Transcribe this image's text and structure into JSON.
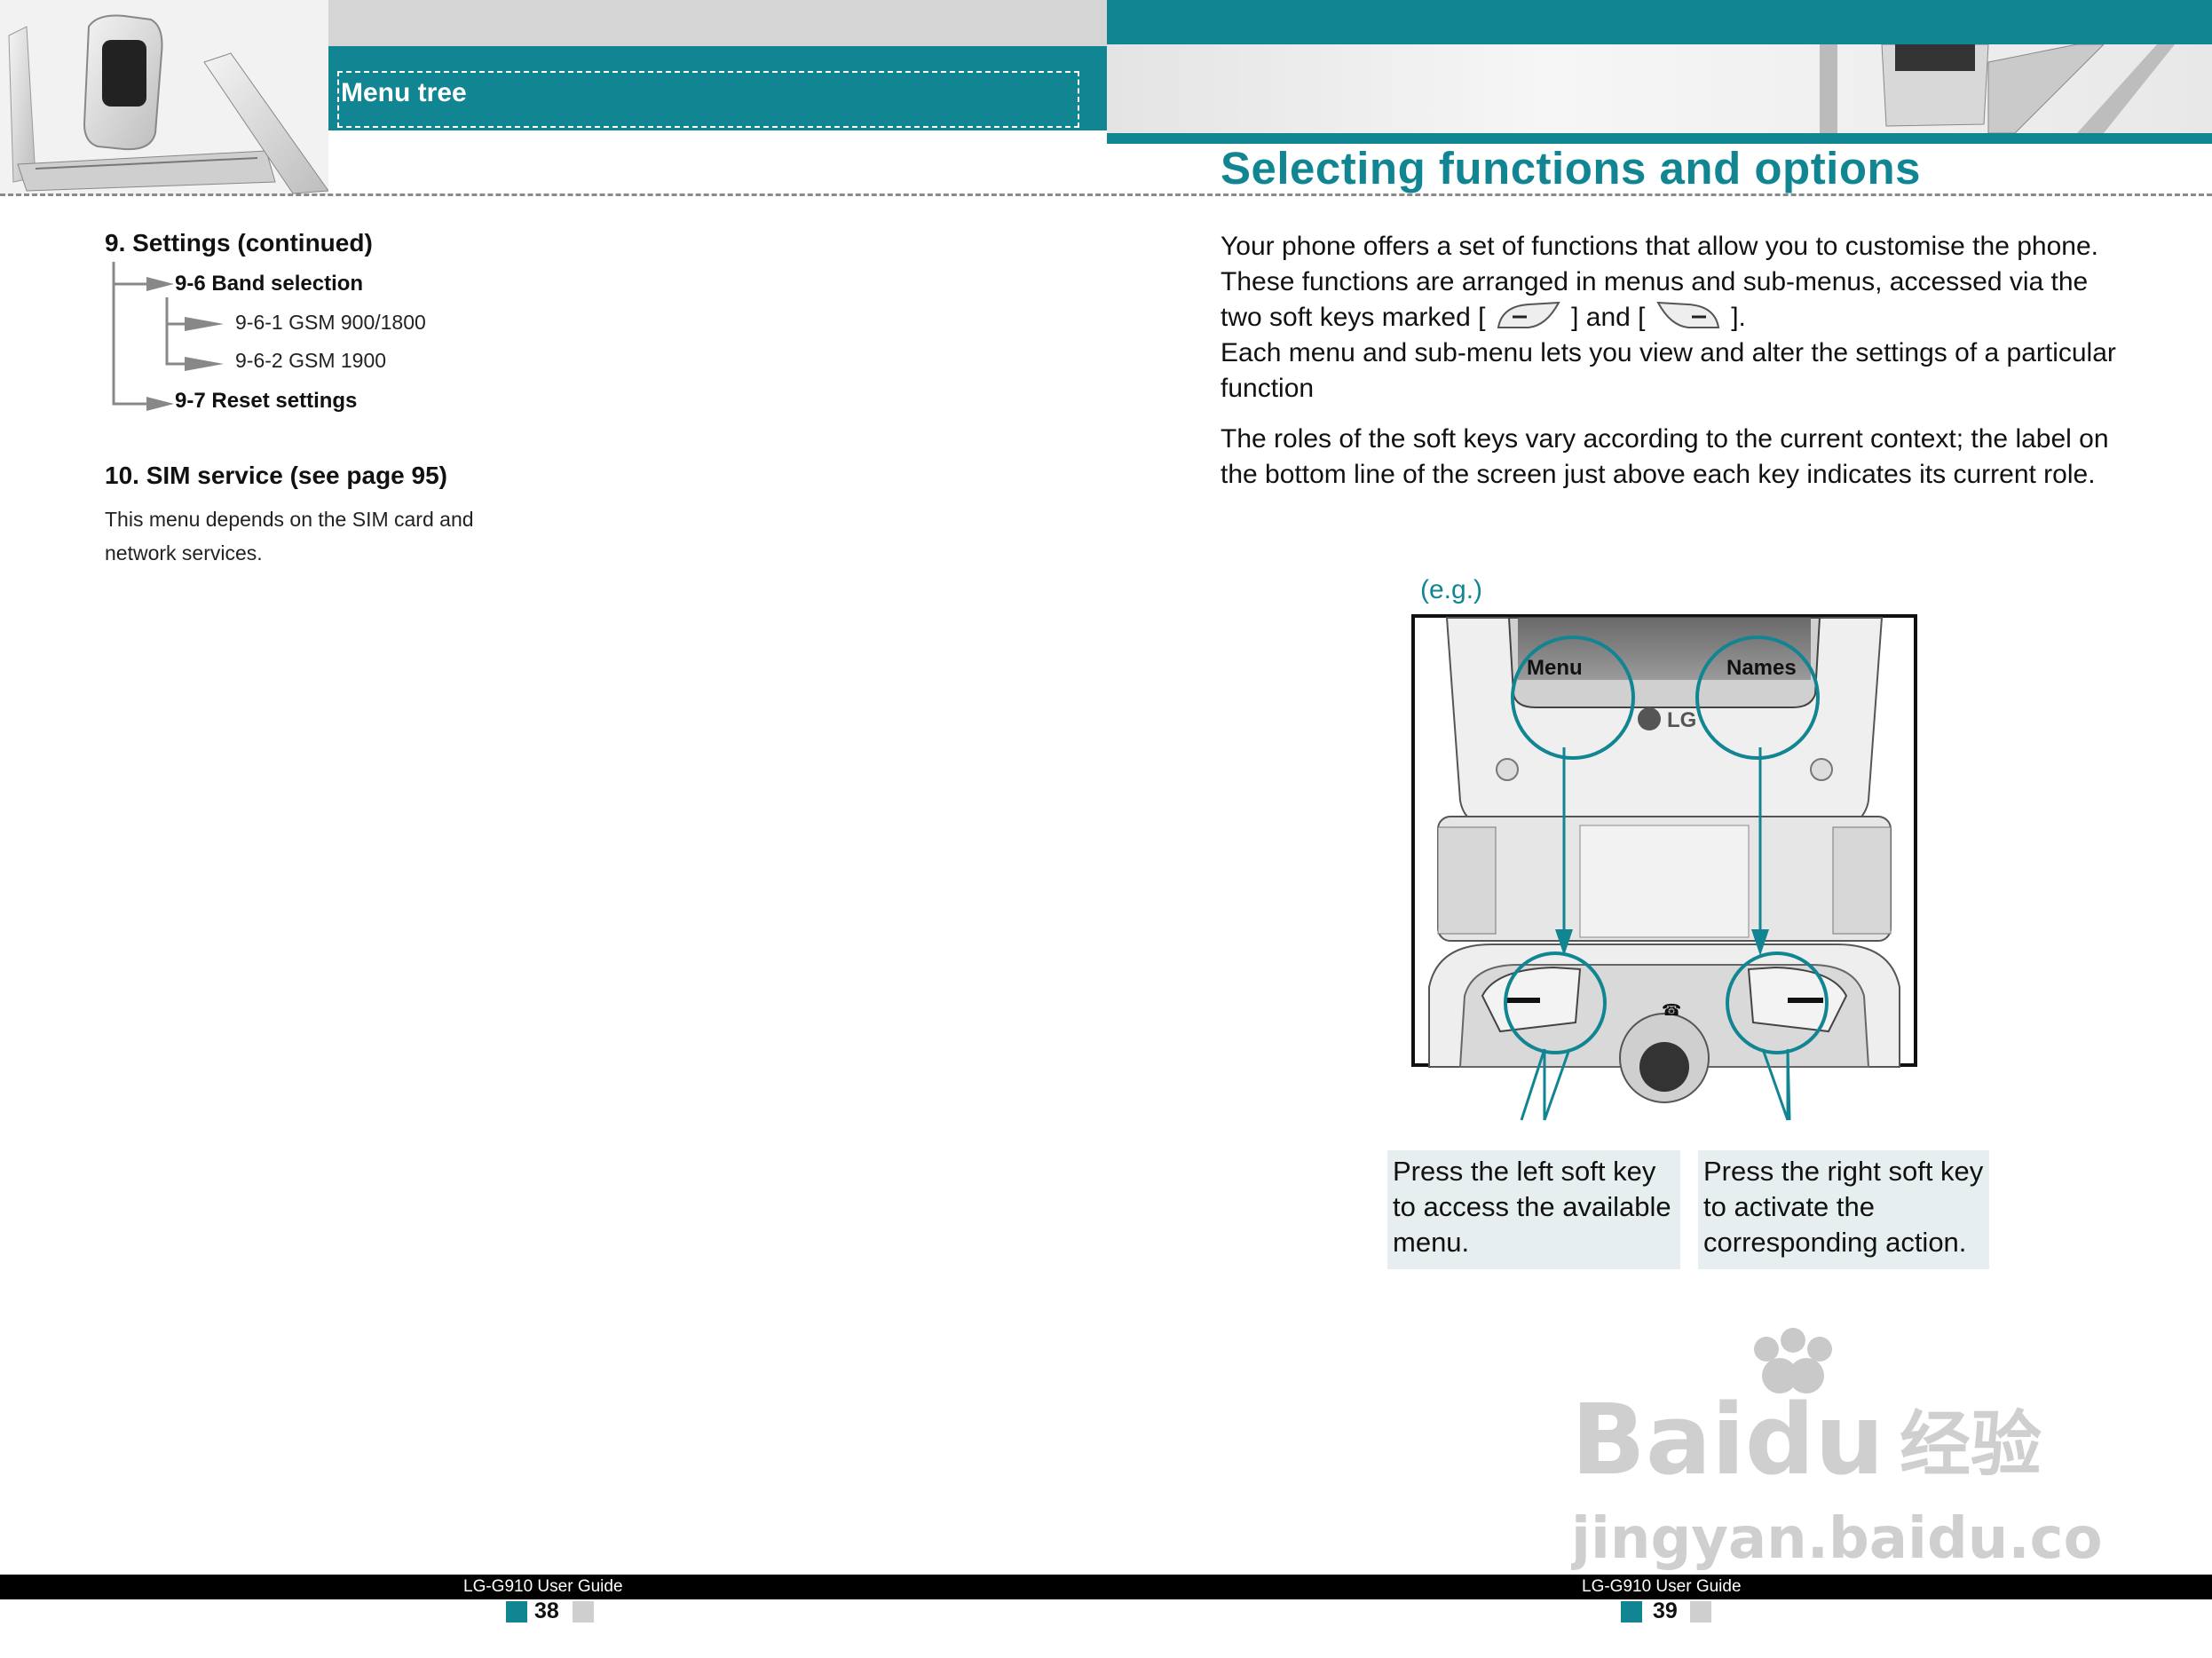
{
  "header": {
    "section_label": "Menu tree",
    "page_title": "Selecting functions and options"
  },
  "left_page": {
    "settings_heading": "9. Settings (continued)",
    "tree": [
      {
        "label": "9-6 Band selection",
        "level": 1
      },
      {
        "label": "9-6-1 GSM 900/1800",
        "level": 2
      },
      {
        "label": "9-6-2 GSM 1900",
        "level": 2
      },
      {
        "label": "9-7 Reset settings",
        "level": 1
      }
    ],
    "sim_heading": "10. SIM service (see page 95)",
    "sim_desc_1": "This menu depends on the SIM card and",
    "sim_desc_2": "network services."
  },
  "right_page": {
    "para1_a": "Your phone offers a set of functions that allow you to customise the phone. These functions are arranged in menus and sub-menus, accessed via the two soft keys marked [",
    "para1_b": "] and [",
    "para1_c": "].",
    "para1_d": "Each menu and sub-menu lets you view and alter the settings of a particular function",
    "para2": "The roles of the soft keys vary according to the current context; the label on the bottom line of the screen just above each key indicates its current role.",
    "eg_label": "(e.g.)",
    "screen_left_label": "Menu",
    "screen_right_label": "Names",
    "phone_brand": "LG",
    "caption_left": "Press the left soft key to access the available menu.",
    "caption_right": "Press the right soft key to activate the corresponding action."
  },
  "footer": {
    "left_guide": "LG-G910 User Guide",
    "left_page_num": "38",
    "right_guide": "LG-G910 User Guide",
    "right_page_num": "39"
  },
  "watermark": {
    "brand": "Baidu",
    "brand_cn": "经验",
    "url": "jingyan.baidu.com"
  },
  "colors": {
    "accent": "#128593",
    "band_grey": "#d5d5d5",
    "caption_bg": "#e6eef0"
  }
}
